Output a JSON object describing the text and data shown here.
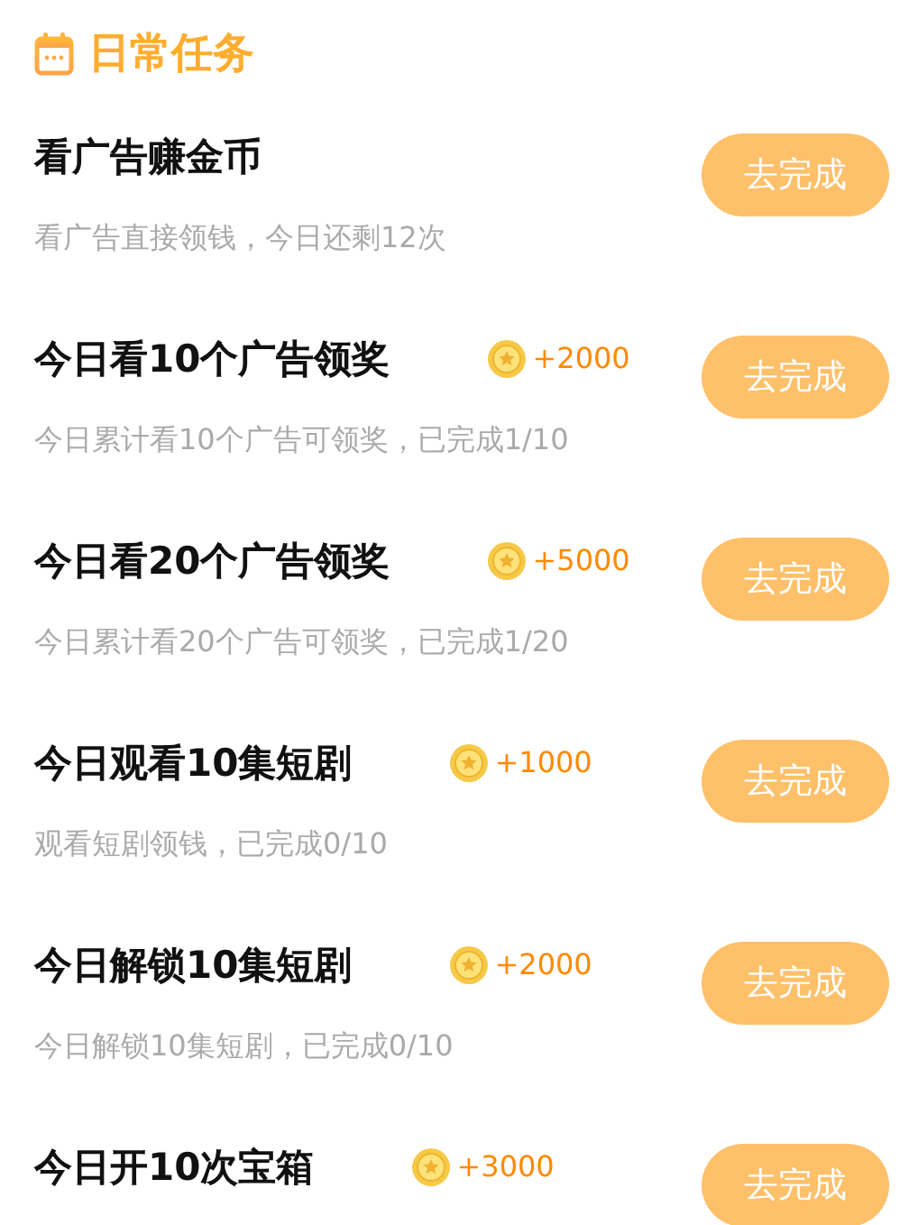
{
  "header": {
    "title": "日常任务"
  },
  "tasks": [
    {
      "title": "看广告赚金币",
      "subtitle": "看广告直接领钱，今日还剩12次",
      "button": "去完成"
    },
    {
      "title": "今日看10个广告领奖",
      "reward": "+2000",
      "subtitle": "今日累计看10个广告可领奖，已完成1/10",
      "button": "去完成"
    },
    {
      "title": "今日看20个广告领奖",
      "reward": "+5000",
      "subtitle": "今日累计看20个广告可领奖，已完成1/20",
      "button": "去完成"
    },
    {
      "title": "今日观看10集短剧",
      "reward": "+1000",
      "subtitle": "观看短剧领钱，已完成0/10",
      "button": "去完成"
    },
    {
      "title": "今日解锁10集短剧",
      "reward": "+2000",
      "subtitle": "今日解锁10集短剧，已完成0/10",
      "button": "去完成"
    },
    {
      "title": "今日开10次宝箱",
      "reward": "+3000",
      "button": "去完成"
    }
  ]
}
